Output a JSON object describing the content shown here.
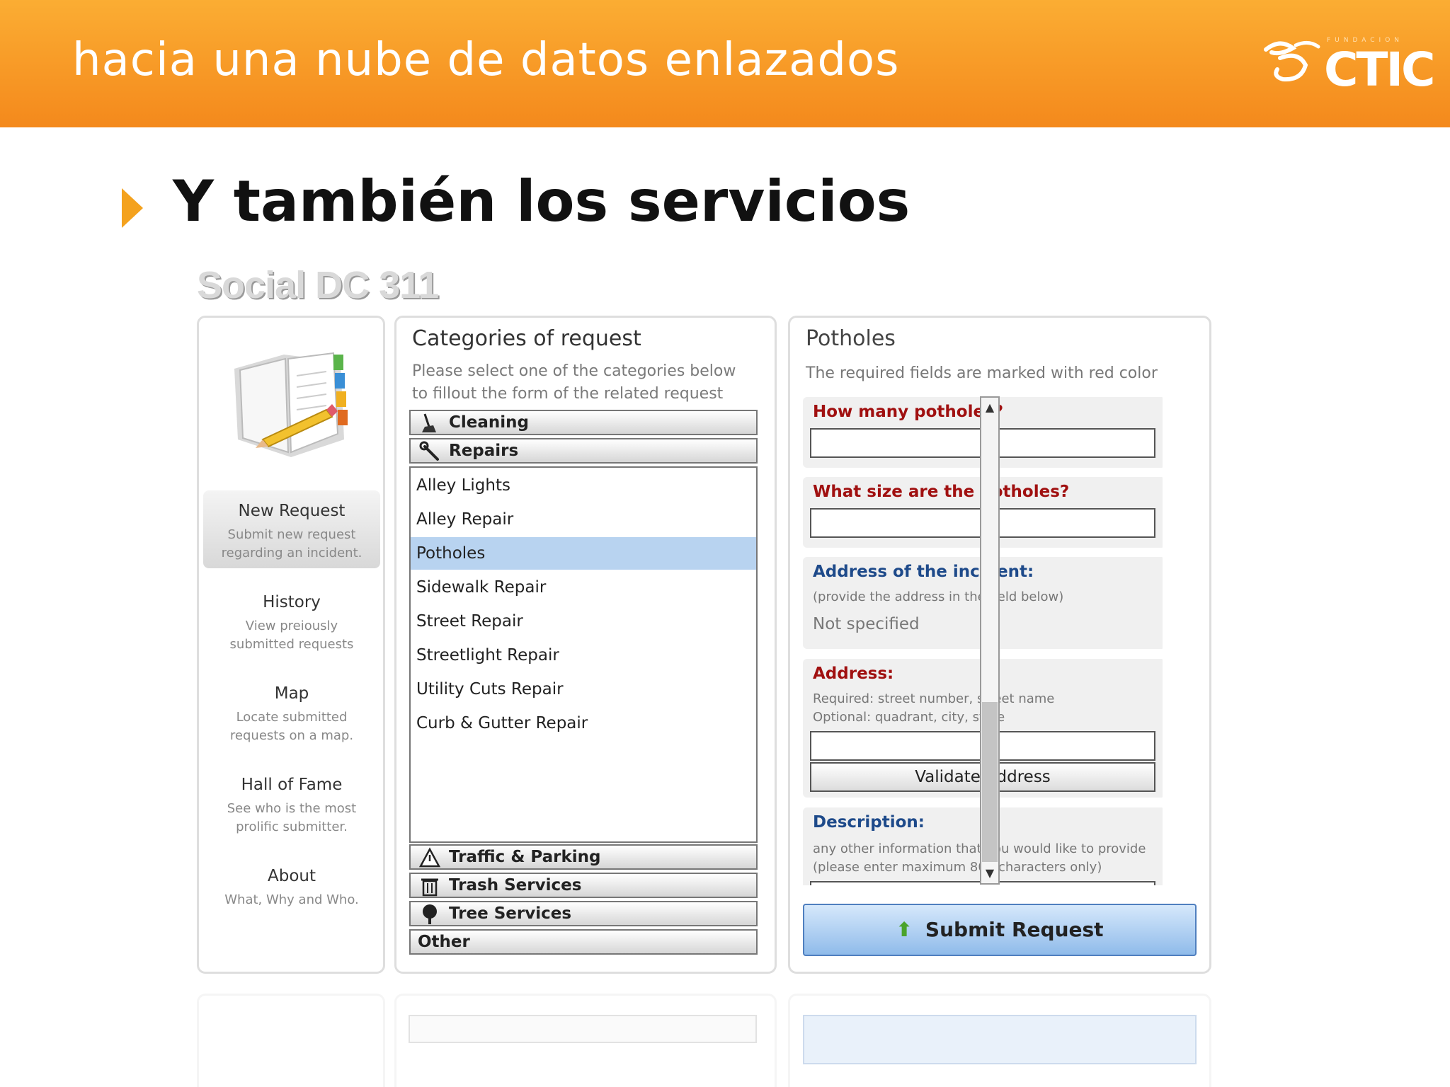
{
  "banner": {
    "title": "hacia una nube de datos enlazados",
    "logo_text": "CTIC",
    "logo_fundacion": "FUNDACION"
  },
  "heading": "Y también los servicios",
  "app": {
    "name": "Social DC 311",
    "nav": [
      {
        "title": "New Request",
        "desc": "Submit new request regarding an incident."
      },
      {
        "title": "History",
        "desc": "View preiously submitted requests"
      },
      {
        "title": "Map",
        "desc": "Locate submitted requests on a map."
      },
      {
        "title": "Hall of Fame",
        "desc": "See who is the most prolific submitter."
      },
      {
        "title": "About",
        "desc": "What, Why and Who."
      }
    ],
    "categories": {
      "title": "Categories of request",
      "subtitle": "Please select one of the categories below to fillout the form of the related request",
      "top": [
        {
          "label": "Cleaning",
          "icon": "broom-icon"
        },
        {
          "label": "Repairs",
          "icon": "wrench-icon"
        }
      ],
      "items": [
        "Alley Lights",
        "Alley Repair",
        "Potholes",
        "Sidewalk Repair",
        "Street Repair",
        "Streetlight Repair",
        "Utility Cuts Repair",
        "Curb & Gutter Repair"
      ],
      "selected": "Potholes",
      "bottom": [
        {
          "label": "Traffic & Parking",
          "icon": "traffic-sign-icon"
        },
        {
          "label": "Trash Services",
          "icon": "trash-can-icon"
        },
        {
          "label": "Tree Services",
          "icon": "tree-icon"
        },
        {
          "label": "Other",
          "icon": ""
        }
      ]
    },
    "form": {
      "title": "Potholes",
      "subtitle": "The required fields are marked with red color",
      "q1": "How many potholes?",
      "q2": "What size are the potholes?",
      "incident_label": "Address of the incident:",
      "incident_hint": "(provide the address in the field below)",
      "incident_value": "Not specified",
      "address_label": "Address:",
      "address_hint1": "Required: street number, street name",
      "address_hint2": "Optional: quadrant, city, state",
      "validate_label": "Validate Address",
      "desc_label": "Description:",
      "desc_hint1": "any other information that you would like to provide",
      "desc_hint2": "(please enter maximum 800 characters only)",
      "submit_label": "Submit Request"
    }
  }
}
